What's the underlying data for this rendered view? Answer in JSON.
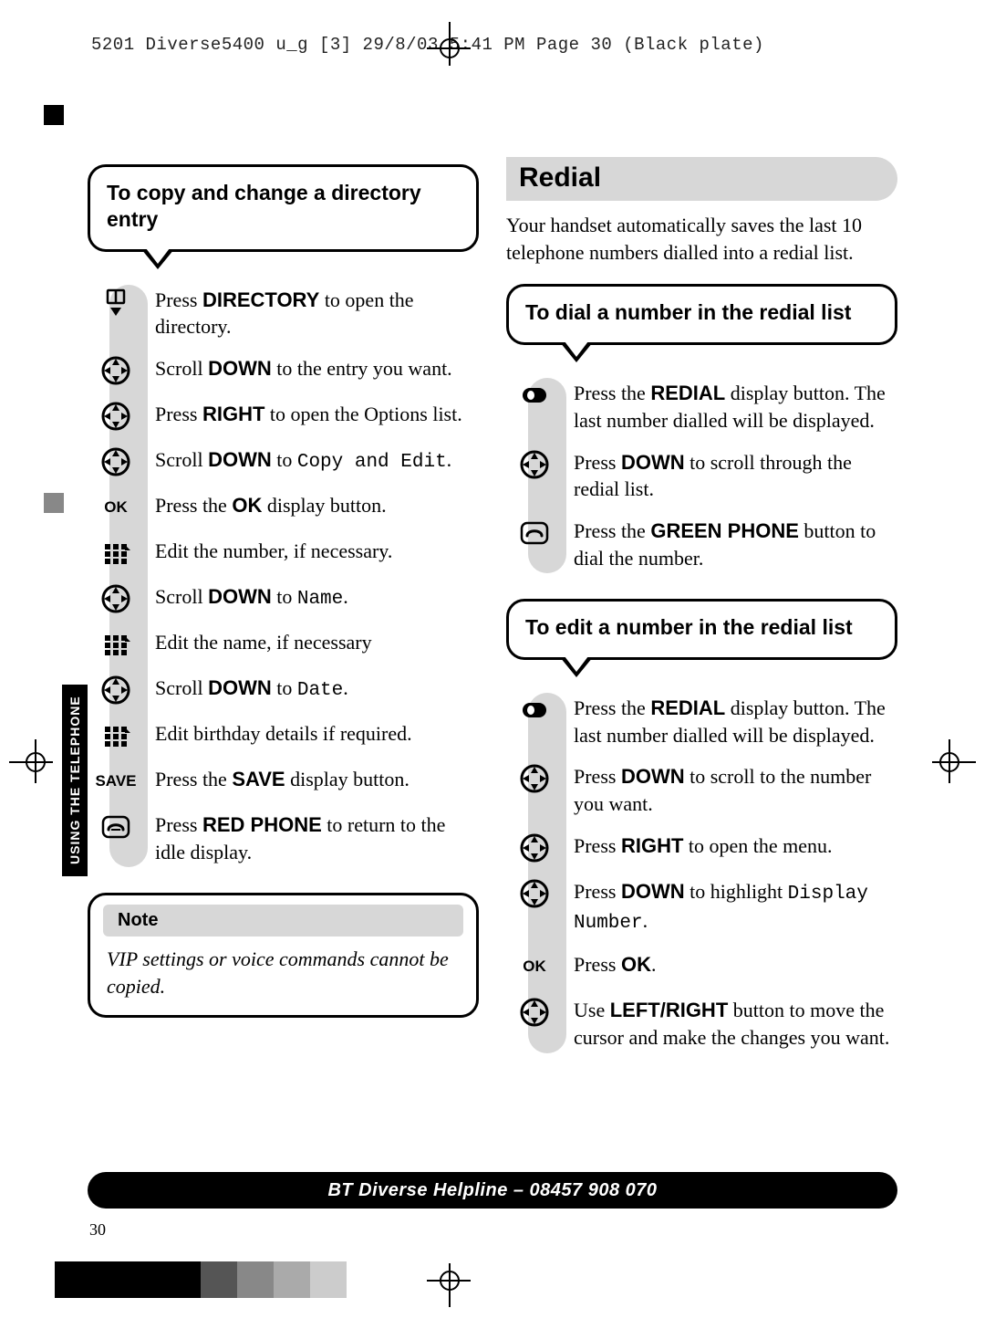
{
  "slug": "5201 Diverse5400  u_g [3]  29/8/03  5:41 PM   Page 30    (Black plate)",
  "side_tab": "USING THE TELEPHONE",
  "page_number": "30",
  "footer": "BT Diverse Helpline – 08457 908 070",
  "left": {
    "callout_title": "To copy and change a directory entry",
    "steps": [
      {
        "icon": "book-down-icon",
        "text": "Press <b>DIRECTORY</b> to open the directory."
      },
      {
        "icon": "nav-pad-icon",
        "text": "Scroll <b>DOWN</b> to the entry you want."
      },
      {
        "icon": "nav-pad-icon",
        "text": "Press <b>RIGHT</b> to open the Options list."
      },
      {
        "icon": "nav-pad-icon",
        "text": "Scroll <b>DOWN</b> to <m>Copy and Edit</m>."
      },
      {
        "icon": "ok",
        "text": "Press the <b>OK</b> display button."
      },
      {
        "icon": "keypad-icon",
        "text": "Edit the number, if necessary."
      },
      {
        "icon": "nav-pad-icon",
        "text": "Scroll <b>DOWN</b> to <m>Name</m>."
      },
      {
        "icon": "keypad-icon",
        "text": "Edit the name, if necessary"
      },
      {
        "icon": "nav-pad-icon",
        "text": "Scroll <b>DOWN</b> to <m>Date</m>."
      },
      {
        "icon": "keypad-icon",
        "text": "Edit birthday details if required."
      },
      {
        "icon": "save",
        "text": "Press the <b>SAVE</b> display button."
      },
      {
        "icon": "red-phone-icon",
        "text": "Press <b>RED PHONE</b> to return to the idle display."
      }
    ],
    "note_head": "Note",
    "note_body": "VIP settings or voice commands cannot be copied."
  },
  "right": {
    "section": "Redial",
    "intro": "Your handset automatically saves the last 10 telephone numbers dialled into a redial list.",
    "dial_callout": "To dial a number in the redial list",
    "dial_steps": [
      {
        "icon": "softkey-icon",
        "text": "Press the <b>REDIAL</b> display button. The last number dialled will be displayed."
      },
      {
        "icon": "nav-pad-icon",
        "text": "Press <b>DOWN</b> to scroll through the redial list."
      },
      {
        "icon": "green-phone-icon",
        "text": "Press the <b>GREEN PHONE</b> button to dial the number."
      }
    ],
    "edit_callout": "To edit a number in the redial list",
    "edit_steps": [
      {
        "icon": "softkey-icon",
        "text": "Press the <b>REDIAL</b> display button. The last number dialled will be displayed."
      },
      {
        "icon": "nav-pad-icon",
        "text": "Press <b>DOWN</b> to scroll to the number you want."
      },
      {
        "icon": "nav-pad-icon",
        "text": "Press <b>RIGHT</b> to open the menu."
      },
      {
        "icon": "nav-pad-icon",
        "text": "Press <b>DOWN</b> to highlight <m>Display Number</m>."
      },
      {
        "icon": "ok",
        "text": "Press <b>OK</b>."
      },
      {
        "icon": "nav-pad-icon",
        "text": "Use <b>LEFT/RIGHT</b> button to move the cursor and make the changes you want."
      }
    ]
  },
  "swatch_colors": [
    "#000",
    "#000",
    "#000",
    "#000",
    "#555",
    "#888",
    "#aaa",
    "#ccc"
  ]
}
